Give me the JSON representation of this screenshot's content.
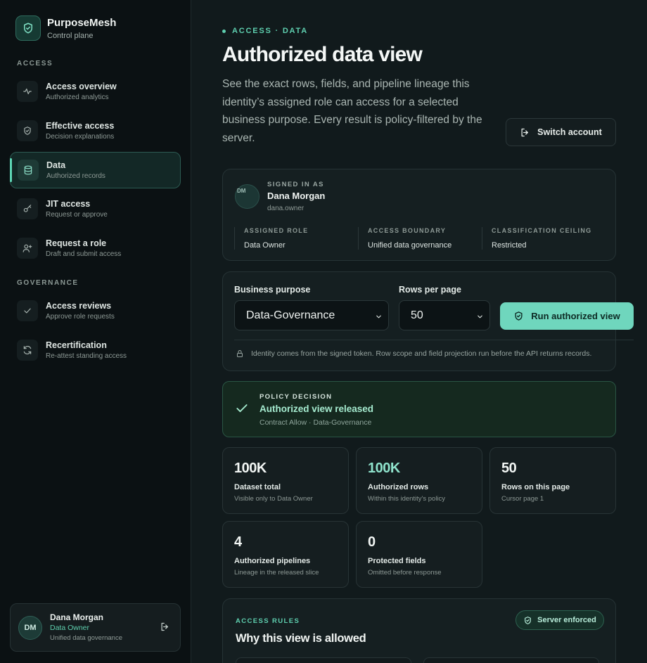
{
  "brand": {
    "name": "PurposeMesh",
    "subtitle": "Control plane",
    "icon": "shield-check-icon"
  },
  "sidebar": {
    "sections": [
      {
        "label": "ACCESS"
      },
      {
        "label": "GOVERNANCE"
      }
    ],
    "items": [
      {
        "title": "Access overview",
        "subtitle": "Authorized analytics",
        "icon": "activity-icon",
        "active": false
      },
      {
        "title": "Effective access",
        "subtitle": "Decision explanations",
        "icon": "shield-check-icon",
        "active": false
      },
      {
        "title": "Data",
        "subtitle": "Authorized records",
        "icon": "database-icon",
        "active": true
      },
      {
        "title": "JIT access",
        "subtitle": "Request or approve",
        "icon": "key-icon",
        "active": false
      },
      {
        "title": "Request a role",
        "subtitle": "Draft and submit access",
        "icon": "user-plus-icon",
        "active": false
      },
      {
        "title": "Access reviews",
        "subtitle": "Approve role requests",
        "icon": "check-icon",
        "active": false
      },
      {
        "title": "Recertification",
        "subtitle": "Re-attest standing access",
        "icon": "refresh-icon",
        "active": false
      }
    ],
    "user": {
      "initials": "DM",
      "name": "Dana Morgan",
      "role": "Data Owner",
      "scope": "Unified data governance"
    }
  },
  "header": {
    "eyebrow": "ACCESS · DATA",
    "title": "Authorized data view",
    "description": "See the exact rows, fields, and pipeline lineage this identity’s assigned role can access for a selected business purpose. Every result is policy-filtered by the server.",
    "switch_label": "Switch account"
  },
  "identity": {
    "initials": "DM",
    "label": "SIGNED IN AS",
    "name": "Dana Morgan",
    "handle": "dana.owner",
    "columns": [
      {
        "label": "ASSIGNED ROLE",
        "value": "Data Owner"
      },
      {
        "label": "ACCESS BOUNDARY",
        "value": "Unified data governance"
      },
      {
        "label": "CLASSIFICATION CEILING",
        "value": "Restricted"
      }
    ]
  },
  "query": {
    "purpose_label": "Business purpose",
    "purpose_value": "Data-Governance",
    "rows_label": "Rows per page",
    "rows_value": "50",
    "run_label": "Run authorized view",
    "note": "Identity comes from the signed token. Row scope and field projection run before the API returns records."
  },
  "decision": {
    "label": "POLICY DECISION",
    "title": "Authorized view released",
    "subtitle": "Contract Allow · Data-Governance"
  },
  "stats": [
    {
      "value": "100K",
      "label": "Dataset total",
      "sub": "Visible only to Data Owner",
      "accent": false
    },
    {
      "value": "100K",
      "label": "Authorized rows",
      "sub": "Within this identity's policy",
      "accent": true
    },
    {
      "value": "50",
      "label": "Rows on this page",
      "sub": "Cursor page 1",
      "accent": false
    },
    {
      "value": "4",
      "label": "Authorized pipelines",
      "sub": "Lineage in the released slice",
      "accent": false
    },
    {
      "value": "0",
      "label": "Protected fields",
      "sub": "Omitted before response",
      "accent": false
    }
  ],
  "rules": {
    "label": "ACCESS RULES",
    "title": "Why this view is allowed",
    "badge": "Server enforced"
  },
  "colors": {
    "accent": "#5fd0b0",
    "button": "#6fd6bd",
    "background": "#111a1c",
    "sidebar": "#0b1113"
  }
}
